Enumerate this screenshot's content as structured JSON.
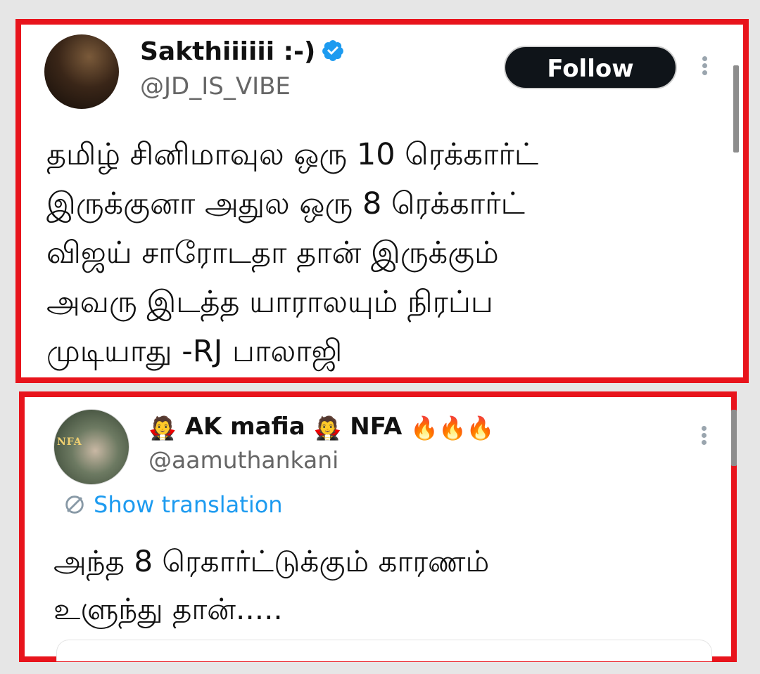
{
  "tweet1": {
    "display_name": "Sakthiiiiii :-)",
    "handle": "@JD_IS_VIBE",
    "follow_label": "Follow",
    "text": "தமிழ் சினிமாவுல ஒரு 10 ரெக்கார்ட்\nஇருக்குனா அதுல ஒரு 8 ரெக்கார்ட்\nவிஜய் சாரோடதா தான் இருக்கும்\nஅவரு இடத்த யாராலயும் நிரப்ப\nமுடியாது -RJ பாலாஜி"
  },
  "tweet2": {
    "emoji_vampire": "🧛",
    "name_part1": "AK mafia",
    "name_part2": "NFA",
    "fire": "🔥🔥🔥",
    "handle": "@aamuthankani",
    "avatar_text": "NFA",
    "translation_label": "Show translation",
    "text": "அந்த 8 ரெகார்ட்டுக்கும் காரணம்\nஉளுந்து தான்....."
  },
  "colors": {
    "highlight_border": "#e8141c",
    "verified_blue": "#1d9bf0",
    "link_blue": "#1d9bf0",
    "follow_bg": "#0f1419"
  },
  "icons": [
    "verified-badge-icon",
    "more-options-icon",
    "translate-icon"
  ]
}
